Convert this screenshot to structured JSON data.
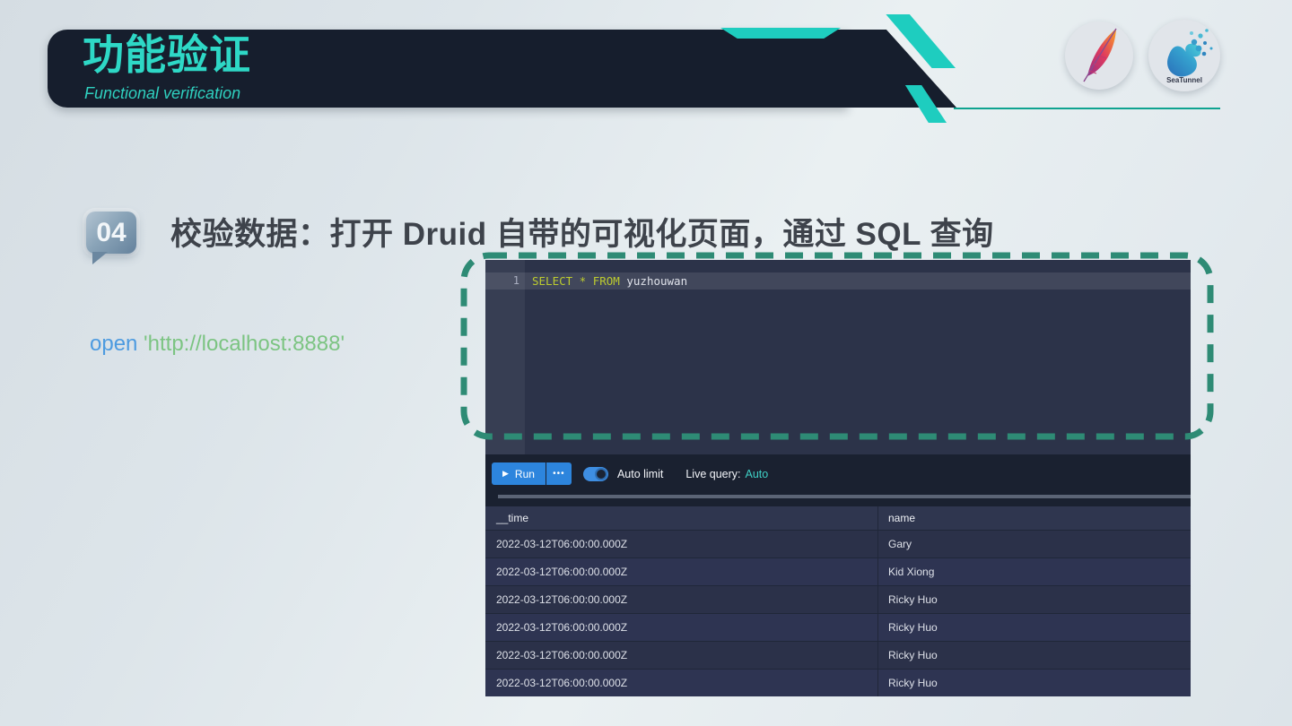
{
  "header": {
    "title": "功能验证",
    "subtitle": "Functional verification"
  },
  "logos": {
    "seatunnel_label": "SeaTunnel"
  },
  "step": {
    "number": "04",
    "title": "校验数据：打开 Druid 自带的可视化页面，通过 SQL 查询"
  },
  "command": {
    "command_word": "open",
    "argument": " 'http://localhost:8888'"
  },
  "druid_console": {
    "editor": {
      "line_number": "1",
      "sql_select": "SELECT",
      "sql_star": " * ",
      "sql_from": "FROM",
      "sql_table": " yuzhouwan"
    },
    "toolbar": {
      "play_icon": "▶",
      "run_label": "Run",
      "more_icon": "•••",
      "auto_limit_label": "Auto limit",
      "live_query_label": "Live query:",
      "live_query_value": "Auto"
    },
    "table": {
      "columns": [
        "__time",
        "name"
      ],
      "rows": [
        [
          "2022-03-12T06:00:00.000Z",
          "Gary"
        ],
        [
          "2022-03-12T06:00:00.000Z",
          "Kid Xiong"
        ],
        [
          "2022-03-12T06:00:00.000Z",
          "Ricky Huo"
        ],
        [
          "2022-03-12T06:00:00.000Z",
          "Ricky Huo"
        ],
        [
          "2022-03-12T06:00:00.000Z",
          "Ricky Huo"
        ],
        [
          "2022-03-12T06:00:00.000Z",
          "Ricky Huo"
        ]
      ]
    }
  },
  "colors": {
    "accent_teal": "#1ecdbf",
    "header_title_teal": "#2ed8c6",
    "dashed_border_green": "#2e8b75",
    "run_button_blue": "#2d85dd",
    "live_query_value_teal": "#3fd0c5",
    "sql_keyword_yellow": "#bccb2f",
    "command_blue": "#4d9be0",
    "command_green": "#7cc482"
  }
}
